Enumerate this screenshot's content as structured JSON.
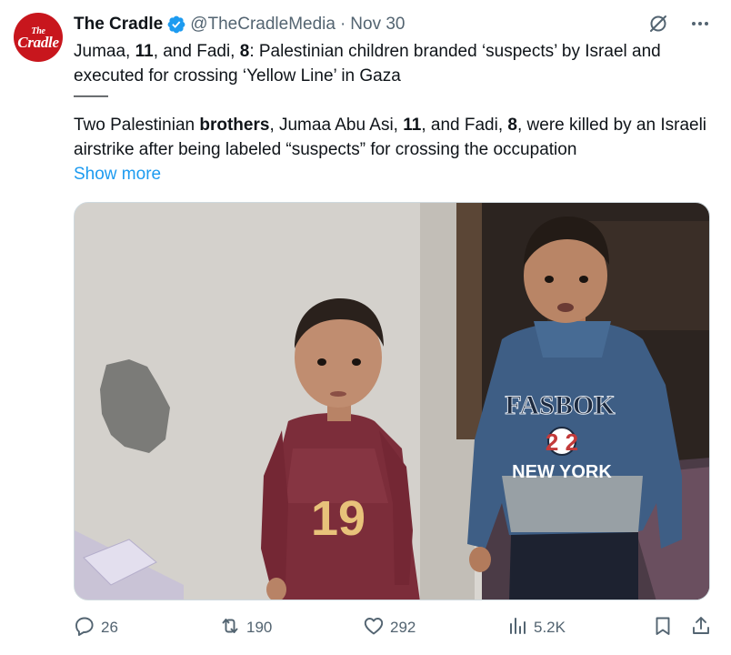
{
  "author": {
    "display_name": "The Cradle",
    "handle": "@TheCradleMedia",
    "separator": "·",
    "date": "Nov 30",
    "avatar_text_top": "The",
    "avatar_text_bottom": "Cradle",
    "avatar_color": "#c8161d",
    "verified": true
  },
  "tweet": {
    "line1_parts": [
      "Jumaa, ",
      "11",
      ", and Fadi, ",
      "8",
      ": Palestinian children branded ‘suspects’ by Israel and executed for crossing ‘Yellow Line’ in Gaza"
    ],
    "separator": "——",
    "line2_parts": [
      "Two Palestinian ",
      "brothers",
      ", Jumaa Abu Asi, ",
      "11",
      ", and Fadi, ",
      "8",
      ", were killed by an Israeli airstrike after being labeled “suspects” for crossing the occupation"
    ],
    "show_more": "Show more"
  },
  "media": {
    "shirt_left_number": "19",
    "shirt_right_brand": "FASBOK",
    "shirt_right_city": "NEW YORK",
    "shirt_right_year": "2  2"
  },
  "metrics": {
    "replies": "26",
    "reposts": "190",
    "likes": "292",
    "views": "5.2K"
  },
  "icons": {
    "verified": "verified-badge-icon",
    "grok": "grok-icon",
    "more": "more-icon",
    "reply": "reply-icon",
    "repost": "repost-icon",
    "like": "heart-icon",
    "views": "views-icon",
    "bookmark": "bookmark-icon",
    "share": "share-icon"
  },
  "colors": {
    "link": "#1d9bf0",
    "secondary_text": "#536471",
    "verified": "#1d9bf0"
  }
}
